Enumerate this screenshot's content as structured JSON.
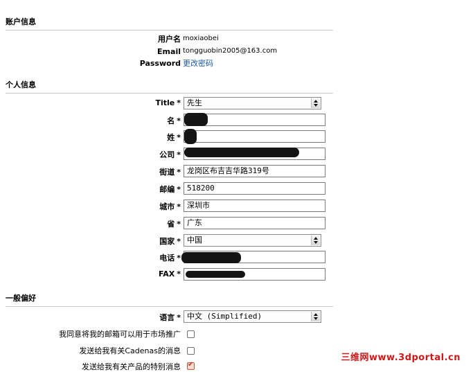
{
  "sections": {
    "account": "账户信息",
    "personal": "个人信息",
    "preferences": "一般偏好"
  },
  "account": {
    "username_label": "用户名",
    "username_value": "moxiaobei",
    "email_label": "Email",
    "email_value": "tongguobin2005@163.com",
    "password_label": "Password",
    "password_link": "更改密码"
  },
  "personal": {
    "title_label": "Title",
    "title_value": "先生",
    "name_label": "名",
    "surname_label": "姓",
    "company_label": "公司",
    "street_label": "街道",
    "street_value": "龙岗区布吉吉华路319号",
    "zip_label": "邮编",
    "zip_value": "518200",
    "city_label": "城市",
    "city_value": "深圳市",
    "province_label": "省",
    "province_value": "广东",
    "country_label": "国家",
    "country_value": "中国",
    "phone_label": "电话",
    "fax_label": "FAX",
    "required_mark": "*"
  },
  "preferences": {
    "language_label": "语言",
    "language_value": "中文 (Simplified)",
    "opt_marketing": "我同意将我的邮箱可以用于市场推广",
    "opt_marketing_checked": false,
    "opt_cadenas": "发送给我有关Cadenas的消息",
    "opt_cadenas_checked": false,
    "opt_special": "发送给我有关产品的特别消息",
    "opt_special_checked": true
  },
  "watermark": "三维网www.3dportal.cn"
}
